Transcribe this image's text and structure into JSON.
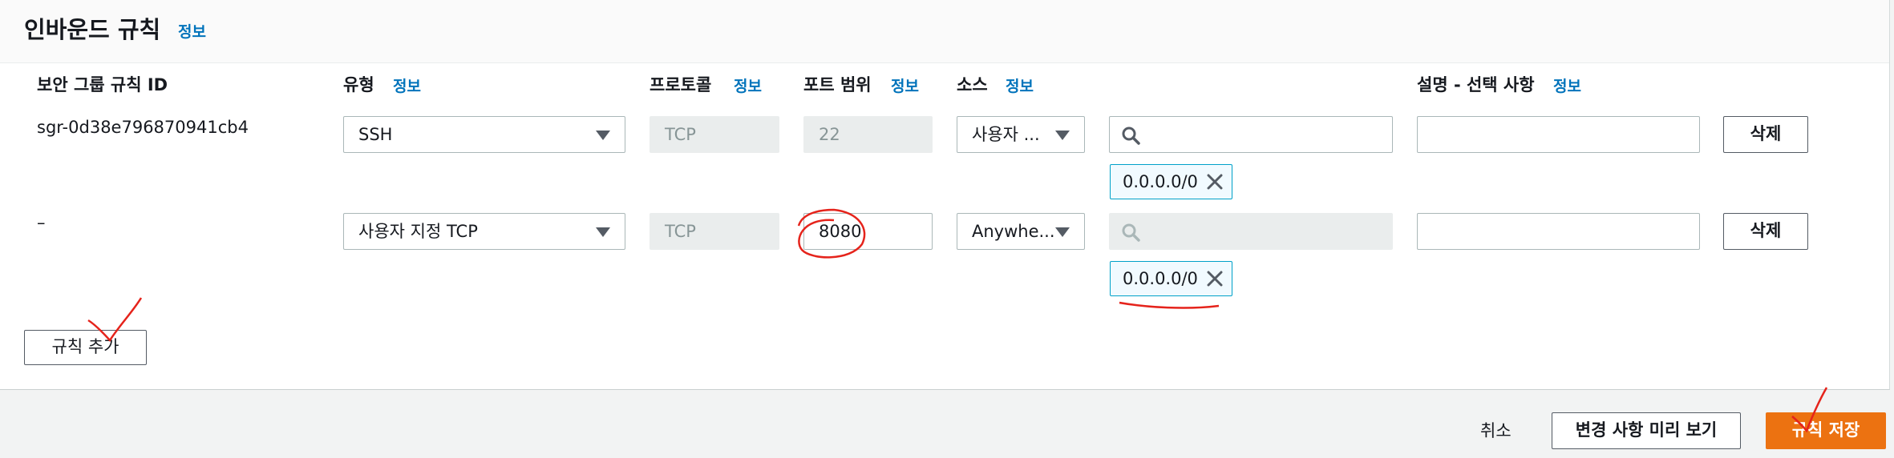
{
  "section": {
    "title": "인바운드 규칙",
    "info": "정보"
  },
  "columns": {
    "rule_id": "보안 그룹 규칙 ID",
    "type": "유형",
    "type_info": "정보",
    "protocol": "프로토콜",
    "protocol_info": "정보",
    "port_range": "포트 범위",
    "port_info": "정보",
    "source": "소스",
    "source_info": "정보",
    "description": "설명 - 선택 사항",
    "description_info": "정보"
  },
  "rules": [
    {
      "id": "sgr-0d38e796870941cb4",
      "type": "SSH",
      "protocol": "TCP",
      "port": "22",
      "source": "사용자 ...",
      "search_value": "",
      "cidr": "0.0.0.0/0",
      "description": "",
      "delete": "삭제"
    },
    {
      "id": "–",
      "type": "사용자 지정 TCP",
      "protocol": "TCP",
      "port": "8080",
      "source": "Anywhe...",
      "search_value": "",
      "cidr": "0.0.0.0/0",
      "description": "",
      "delete": "삭제"
    }
  ],
  "add_rule": "규칙 추가",
  "footer": {
    "cancel": "취소",
    "preview": "변경 사항 미리 보기",
    "save": "규칙 저장"
  },
  "colors": {
    "primary": "#ec7211",
    "link": "#0073bb",
    "token_border": "#00a1c9",
    "annotation": "#e5231b"
  }
}
